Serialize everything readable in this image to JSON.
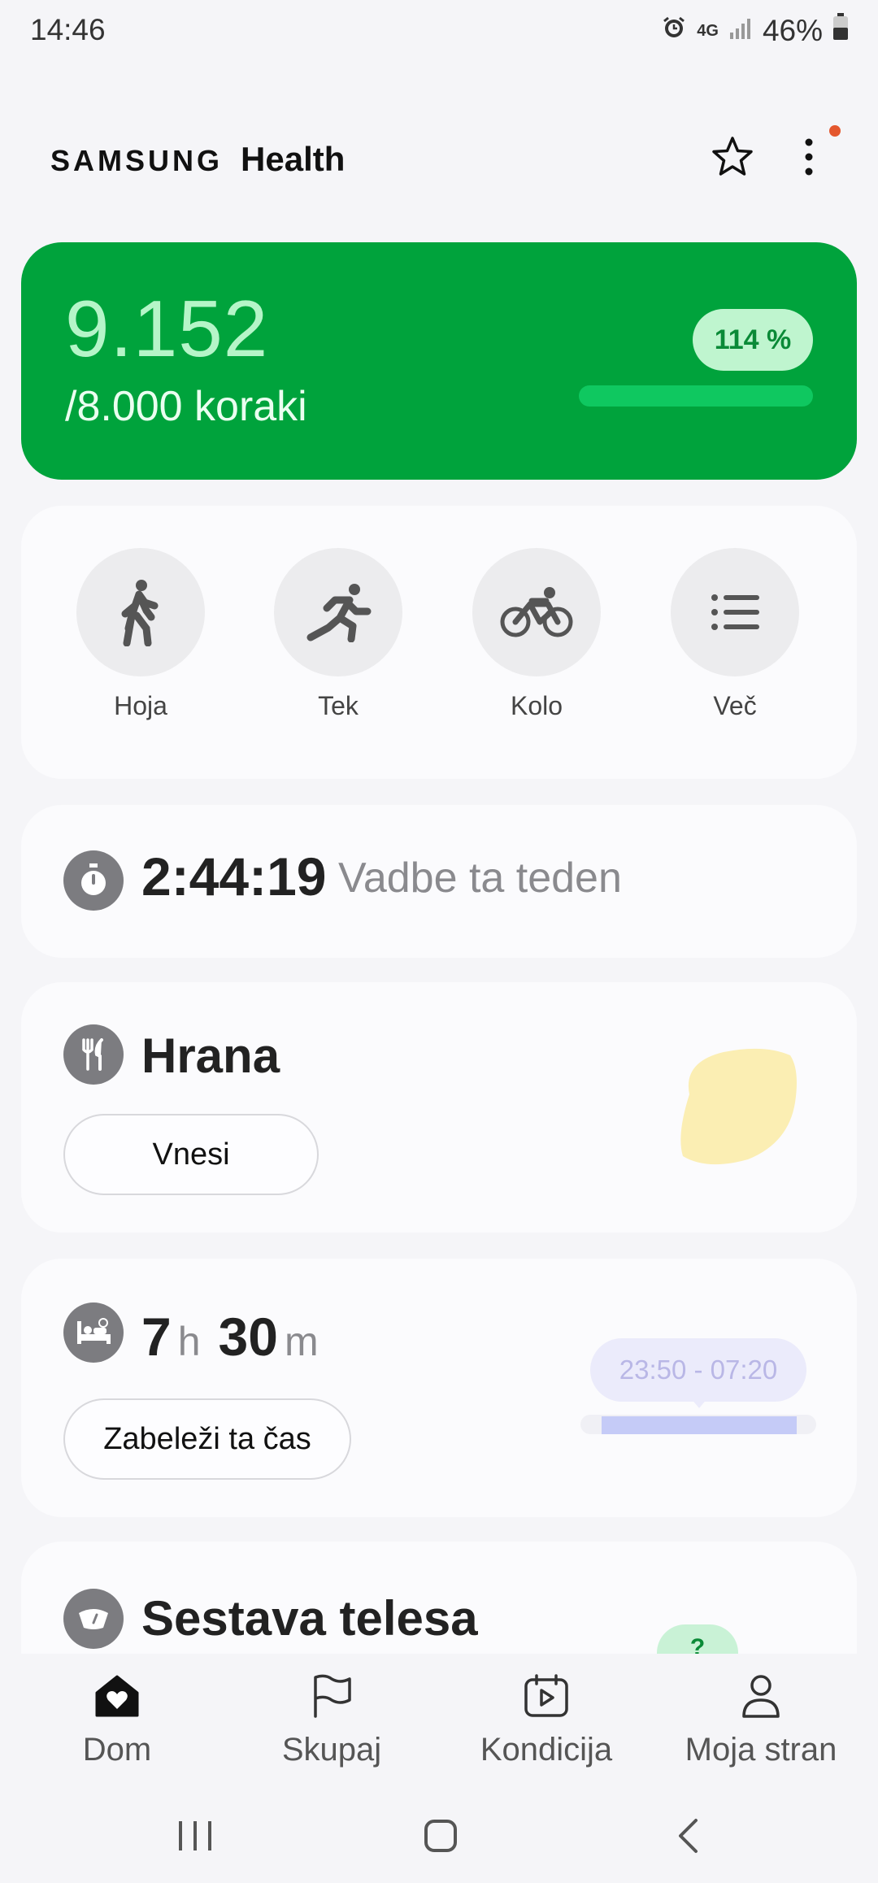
{
  "status_bar": {
    "time": "14:46",
    "network": "4G",
    "battery": "46%"
  },
  "header": {
    "brand": "SAMSUNG",
    "app": "Health",
    "notification_color": "#e4572e"
  },
  "steps": {
    "count": "9.152",
    "goal_label": "/8.000 koraki",
    "percent_label": "114 %",
    "progress_fraction": 1.0,
    "card_color": "#00a33c"
  },
  "activities": [
    {
      "label": "Hoja",
      "icon": "walk-icon"
    },
    {
      "label": "Tek",
      "icon": "run-icon"
    },
    {
      "label": "Kolo",
      "icon": "bike-icon"
    },
    {
      "label": "Več",
      "icon": "list-icon"
    }
  ],
  "exercise": {
    "time": "2:44:19",
    "label": "Vadbe ta teden",
    "icon": "stopwatch-icon"
  },
  "food": {
    "title": "Hrana",
    "button": "Vnesi",
    "icon": "fork-knife-icon"
  },
  "sleep": {
    "hours": "7",
    "hours_unit": "h",
    "minutes": "30",
    "minutes_unit": "m",
    "button": "Zabeleži ta čas",
    "range": "23:50 - 07:20",
    "icon": "bed-icon"
  },
  "body": {
    "title": "Sestava telesa",
    "badge": "?",
    "icon": "scale-icon"
  },
  "bottom_nav": [
    {
      "label": "Dom",
      "icon": "home-heart-icon",
      "active": true
    },
    {
      "label": "Skupaj",
      "icon": "flag-icon",
      "active": false
    },
    {
      "label": "Kondicija",
      "icon": "calendar-play-icon",
      "active": false
    },
    {
      "label": "Moja stran",
      "icon": "person-icon",
      "active": false
    }
  ]
}
